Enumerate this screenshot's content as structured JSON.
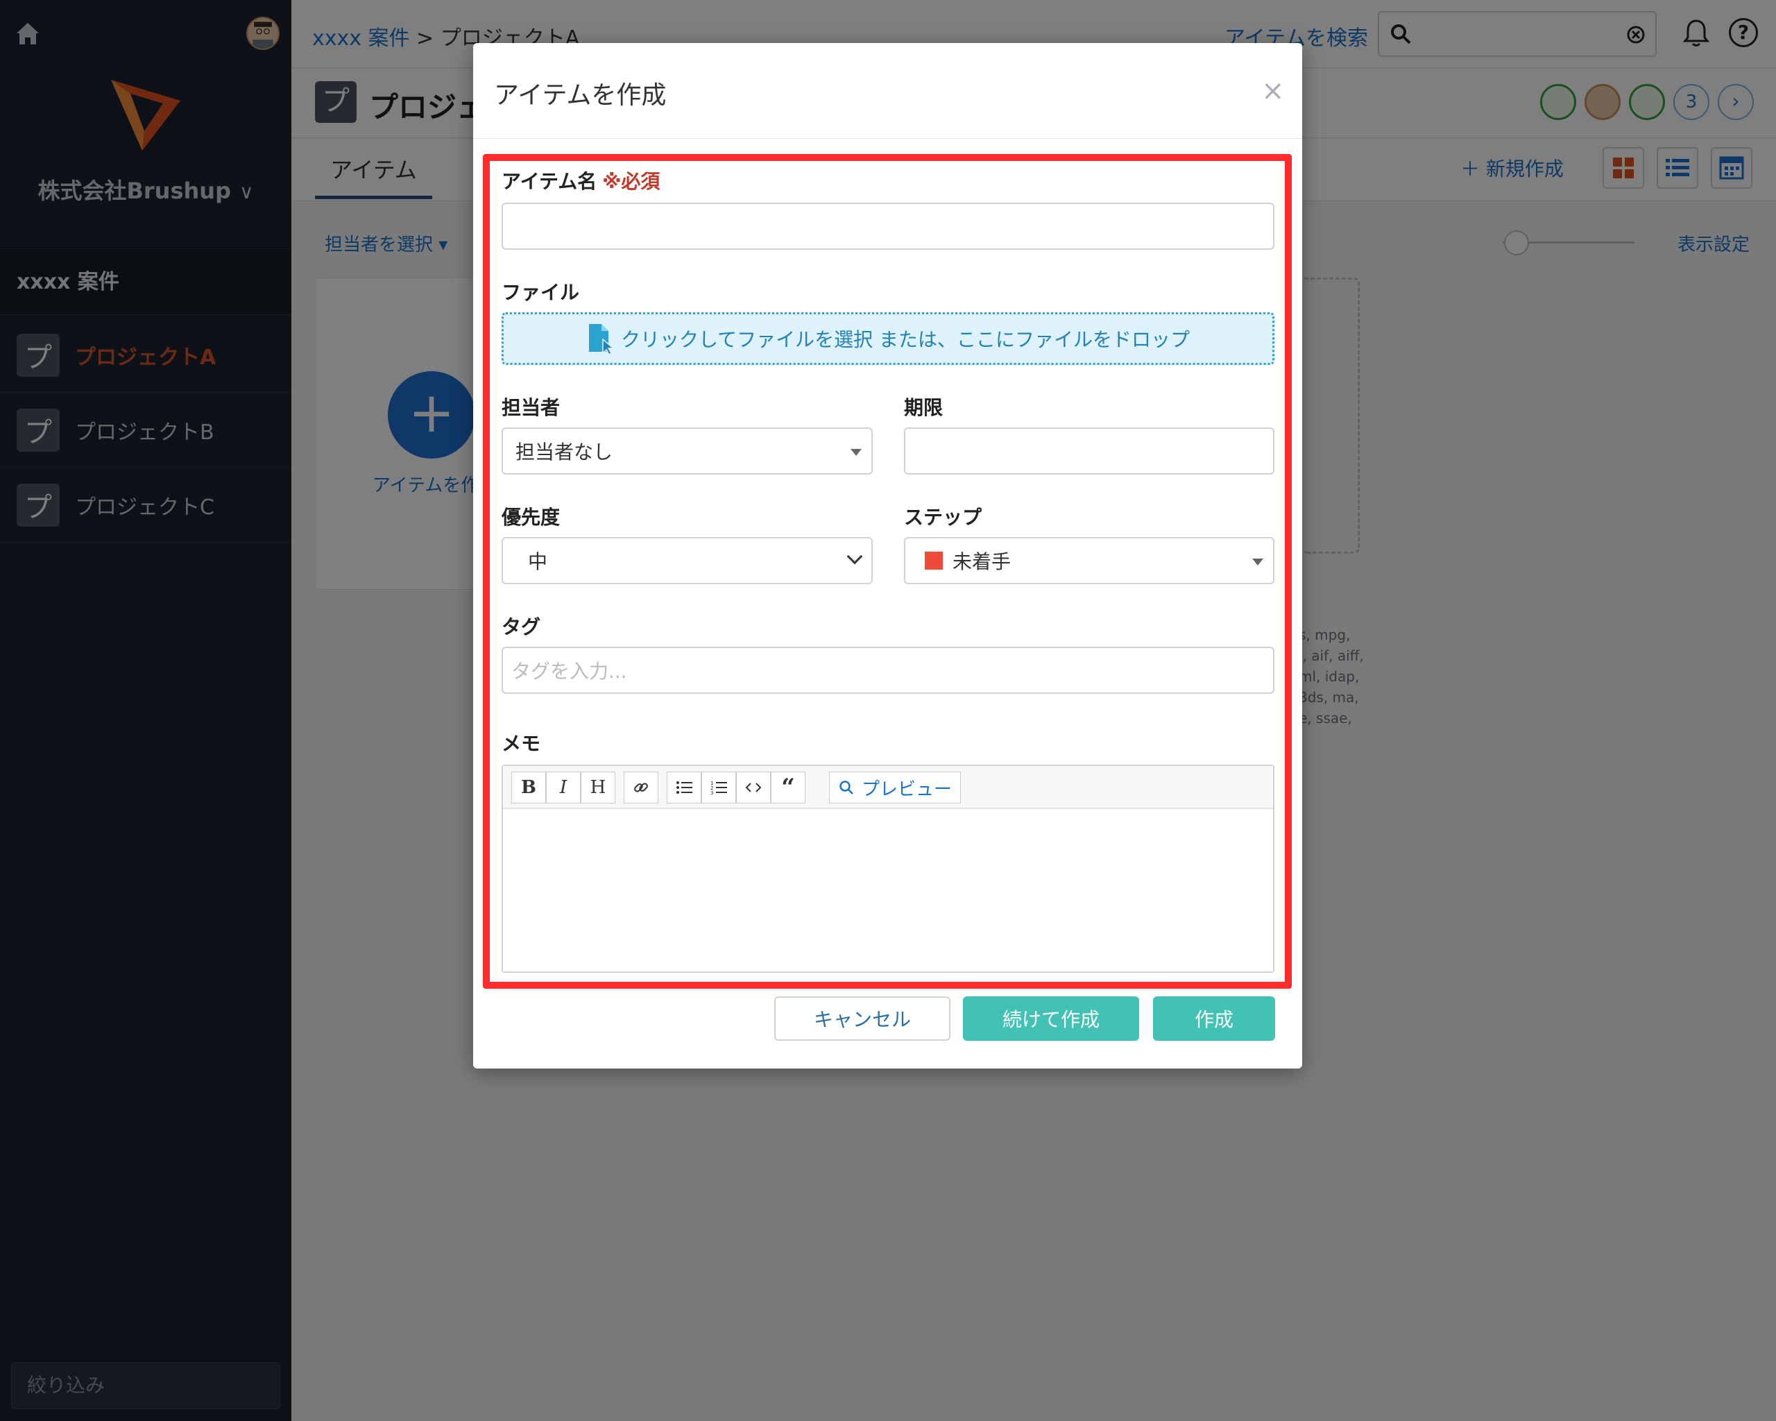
{
  "sidebar": {
    "company": "株式会社Brushup",
    "group_title": "xxxx 案件",
    "projects": [
      {
        "label": "プロジェクトA",
        "icon": "プ",
        "active": true
      },
      {
        "label": "プロジェクトB",
        "icon": "プ",
        "active": false
      },
      {
        "label": "プロジェクトC",
        "icon": "プ",
        "active": false
      }
    ],
    "filter_placeholder": "絞り込み"
  },
  "header": {
    "breadcrumb_link": "xxxx 案件",
    "breadcrumb_sep": ">",
    "breadcrumb_current": "プロジェクトA",
    "search_link": "アイテムを検索",
    "member_count": "3"
  },
  "project": {
    "icon": "プ",
    "title": "プロジェ",
    "tab_items": "アイテム",
    "new_button": "新規作成",
    "assignee_filter": "担当者を選択",
    "display_settings": "表示設定",
    "add_item_label": "アイテムを作",
    "extensions": [
      "s, mpg,",
      "i, aif, aiff,",
      "ml, idap,",
      "3ds, ma,",
      "e, ssae,"
    ]
  },
  "modal": {
    "title": "アイテムを作成",
    "close": "×",
    "fields": {
      "item_name_label": "アイテム名",
      "required_mark": "※必須",
      "item_name_value": "",
      "file_label": "ファイル",
      "file_drop_text": "クリックしてファイルを選択 または、ここにファイルをドロップ",
      "assignee_label": "担当者",
      "assignee_value": "担当者なし",
      "deadline_label": "期限",
      "deadline_value": "",
      "priority_label": "優先度",
      "priority_value": "中",
      "step_label": "ステップ",
      "step_value": "未着手",
      "step_color": "#f04a3a",
      "tag_label": "タグ",
      "tag_placeholder": "タグを入力...",
      "memo_label": "メモ"
    },
    "editor_toolbar": {
      "bold": "B",
      "italic": "I",
      "heading": "H",
      "preview": "プレビュー"
    },
    "buttons": {
      "cancel": "キャンセル",
      "continue_create": "続けて作成",
      "create": "作成"
    }
  },
  "colors": {
    "sidebar_bg": "#1d2531",
    "accent_active": "#d4552b",
    "primary_button": "#42c1b5",
    "highlight": "#ff2b2b",
    "link": "#1a73c8"
  }
}
